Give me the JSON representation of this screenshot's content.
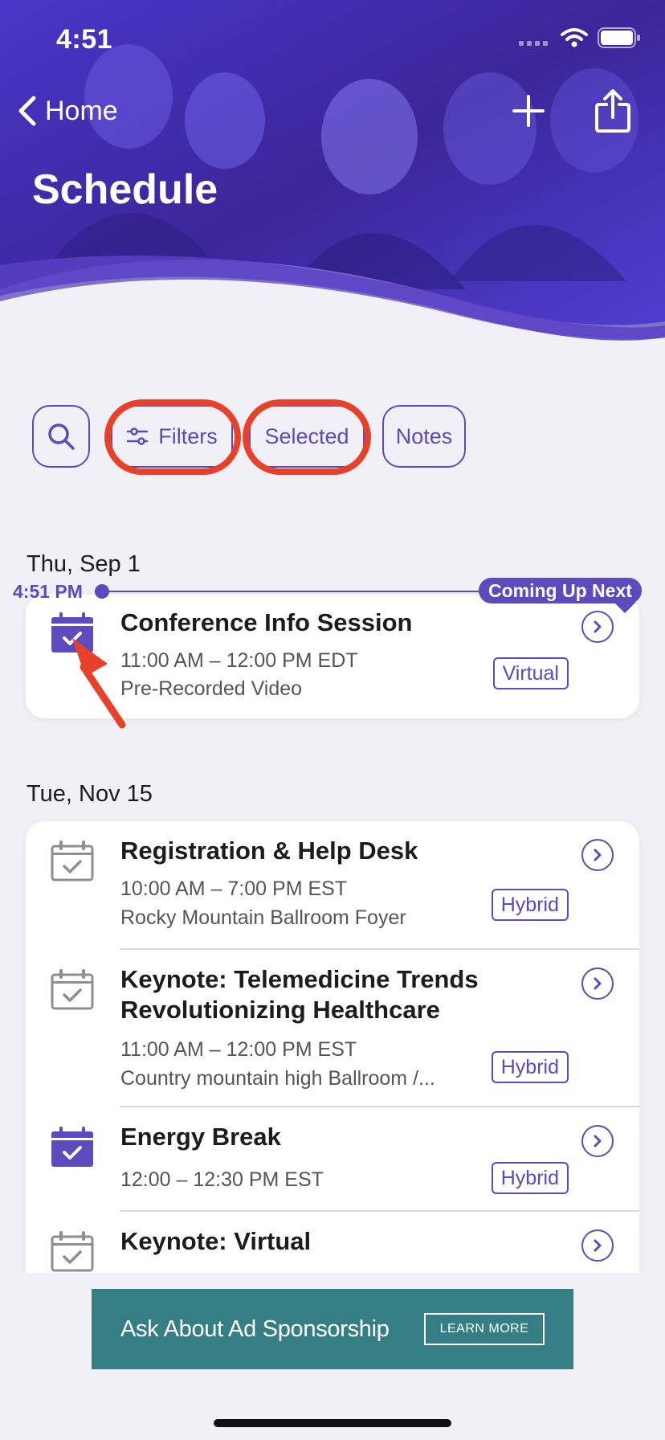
{
  "status": {
    "time": "4:51"
  },
  "nav": {
    "back_label": "Home"
  },
  "page": {
    "title": "Schedule"
  },
  "toolbar": {
    "filters_label": "Filters",
    "selected_label": "Selected",
    "notes_label": "Notes"
  },
  "timeline": {
    "now_time": "4:51 PM",
    "next_label": "Coming Up Next"
  },
  "days": [
    {
      "label": "Thu, Sep 1",
      "sessions": [
        {
          "title": "Conference Info Session",
          "time": "11:00 AM – 12:00 PM EDT",
          "location": "Pre-Recorded Video",
          "tag": "Virtual",
          "selected": true
        }
      ]
    },
    {
      "label": "Tue, Nov 15",
      "sessions": [
        {
          "title": "Registration & Help Desk",
          "time": "10:00 AM – 7:00 PM EST",
          "location": "Rocky Mountain Ballroom Foyer",
          "tag": "Hybrid",
          "selected": false
        },
        {
          "title": "Keynote: Telemedicine Trends Revolutionizing Healthcare",
          "time": "11:00 AM – 12:00 PM EST",
          "location": "Country mountain high Ballroom /...",
          "tag": "Hybrid",
          "selected": false
        },
        {
          "title": "Energy Break",
          "time": "12:00 – 12:30 PM EST",
          "location": "",
          "tag": "Hybrid",
          "selected": true
        },
        {
          "title": "Keynote: Virtual",
          "time": "",
          "location": "",
          "tag": "",
          "selected": false
        }
      ]
    }
  ],
  "ad": {
    "text": "Ask About Ad Sponsorship",
    "button_label": "LEARN MORE"
  },
  "colors": {
    "accent": "#5d4bbd",
    "highlight": "#e8412a",
    "ad_background": "#367e85"
  },
  "icons": [
    "back-chevron-icon",
    "plus-icon",
    "share-icon",
    "search-icon",
    "filter-sliders-icon",
    "calendar-check-icon",
    "chevron-right-circle-icon",
    "wifi-icon",
    "battery-icon",
    "signal-icon"
  ]
}
